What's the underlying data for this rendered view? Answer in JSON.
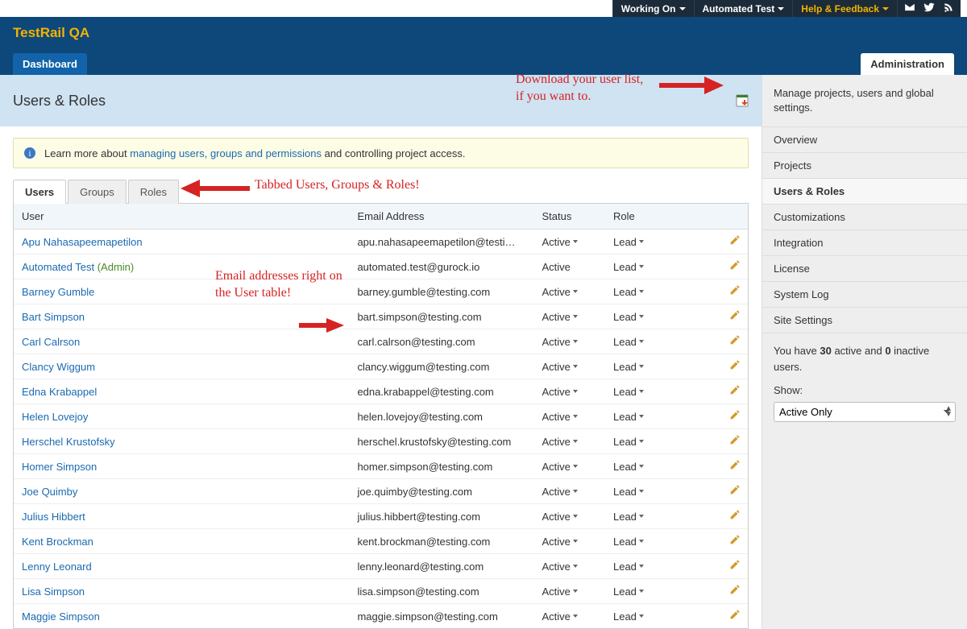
{
  "topnav": {
    "working_on": "Working On",
    "user": "Automated Test",
    "help": "Help & Feedback"
  },
  "brand": "TestRail QA",
  "nav": {
    "dashboard": "Dashboard",
    "administration": "Administration"
  },
  "page_title": "Users & Roles",
  "side_caption": "Manage projects, users and global settings.",
  "info": {
    "prefix": "Learn more about ",
    "link": "managing users, groups and permissions",
    "suffix": " and controlling project access."
  },
  "subtabs": {
    "users": "Users",
    "groups": "Groups",
    "roles": "Roles"
  },
  "columns": {
    "user": "User",
    "email": "Email Address",
    "status": "Status",
    "role": "Role"
  },
  "rows": [
    {
      "name": "Apu Nahasapeemapetilon",
      "admin": false,
      "email": "apu.nahasapeemapetilon@testi…",
      "status": "Active",
      "role": "Lead",
      "status_drop": true
    },
    {
      "name": "Automated Test",
      "admin": true,
      "email": "automated.test@gurock.io",
      "status": "Active",
      "role": "Lead",
      "status_drop": false
    },
    {
      "name": "Barney Gumble",
      "admin": false,
      "email": "barney.gumble@testing.com",
      "status": "Active",
      "role": "Lead",
      "status_drop": true
    },
    {
      "name": "Bart Simpson",
      "admin": false,
      "email": "bart.simpson@testing.com",
      "status": "Active",
      "role": "Lead",
      "status_drop": true
    },
    {
      "name": "Carl Calrson",
      "admin": false,
      "email": "carl.calrson@testing.com",
      "status": "Active",
      "role": "Lead",
      "status_drop": true
    },
    {
      "name": "Clancy Wiggum",
      "admin": false,
      "email": "clancy.wiggum@testing.com",
      "status": "Active",
      "role": "Lead",
      "status_drop": true
    },
    {
      "name": "Edna Krabappel",
      "admin": false,
      "email": "edna.krabappel@testing.com",
      "status": "Active",
      "role": "Lead",
      "status_drop": true
    },
    {
      "name": "Helen Lovejoy",
      "admin": false,
      "email": "helen.lovejoy@testing.com",
      "status": "Active",
      "role": "Lead",
      "status_drop": true
    },
    {
      "name": "Herschel Krustofsky",
      "admin": false,
      "email": "herschel.krustofsky@testing.com",
      "status": "Active",
      "role": "Lead",
      "status_drop": true
    },
    {
      "name": "Homer Simpson",
      "admin": false,
      "email": "homer.simpson@testing.com",
      "status": "Active",
      "role": "Lead",
      "status_drop": true
    },
    {
      "name": "Joe Quimby",
      "admin": false,
      "email": "joe.quimby@testing.com",
      "status": "Active",
      "role": "Lead",
      "status_drop": true
    },
    {
      "name": "Julius Hibbert",
      "admin": false,
      "email": "julius.hibbert@testing.com",
      "status": "Active",
      "role": "Lead",
      "status_drop": true
    },
    {
      "name": "Kent Brockman",
      "admin": false,
      "email": "kent.brockman@testing.com",
      "status": "Active",
      "role": "Lead",
      "status_drop": true
    },
    {
      "name": "Lenny Leonard",
      "admin": false,
      "email": "lenny.leonard@testing.com",
      "status": "Active",
      "role": "Lead",
      "status_drop": true
    },
    {
      "name": "Lisa Simpson",
      "admin": false,
      "email": "lisa.simpson@testing.com",
      "status": "Active",
      "role": "Lead",
      "status_drop": true
    },
    {
      "name": "Maggie Simpson",
      "admin": false,
      "email": "maggie.simpson@testing.com",
      "status": "Active",
      "role": "Lead",
      "status_drop": true
    }
  ],
  "admin_label": "(Admin)",
  "sidenav": {
    "items": [
      "Overview",
      "Projects",
      "Users & Roles",
      "Customizations",
      "Integration",
      "License",
      "System Log",
      "Site Settings"
    ],
    "active_index": 2
  },
  "sidebox": {
    "summary_p1": "You have ",
    "active_count": "30",
    "summary_p2": " active and ",
    "inactive_count": "0",
    "summary_p3": " inactive users.",
    "show_label": "Show:",
    "filter_value": "Active Only"
  },
  "annotations": {
    "download": "Download your user list,\nif you want to.",
    "tabs": "Tabbed Users, Groups & Roles!",
    "email": "Email addresses right on the User table!"
  }
}
